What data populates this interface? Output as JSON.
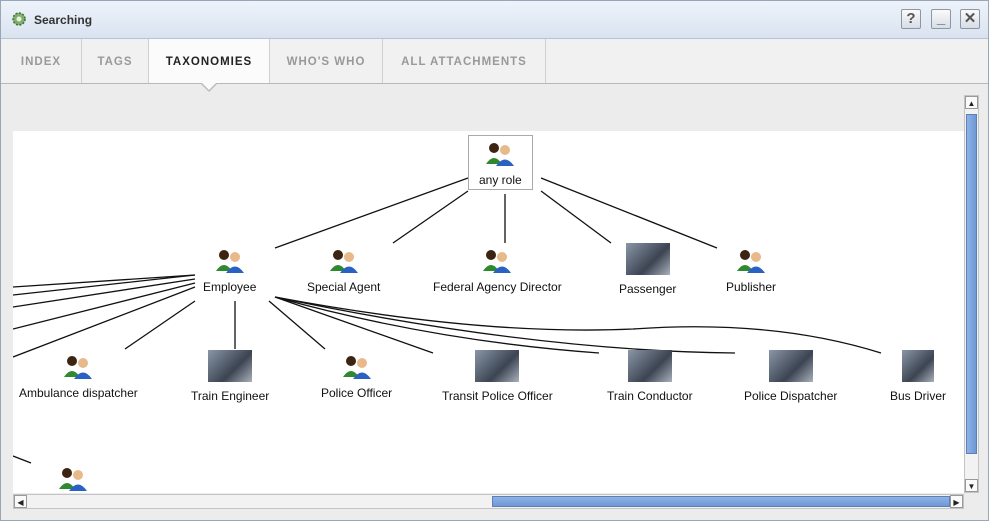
{
  "window": {
    "title": "Searching"
  },
  "controls": {
    "help": "?",
    "minimize": "_",
    "close": "✕"
  },
  "tabs": [
    {
      "label": "INDEX"
    },
    {
      "label": "TAGS"
    },
    {
      "label": "TAXONOMIES"
    },
    {
      "label": "WHO'S WHO"
    },
    {
      "label": "ALL ATTACHMENTS"
    }
  ],
  "active_tab": "TAXONOMIES",
  "taxonomy": {
    "root": {
      "label": "any role",
      "icon": "people-icon"
    },
    "level1": [
      {
        "label": "Employee",
        "icon": "people-icon"
      },
      {
        "label": "Special Agent",
        "icon": "people-icon"
      },
      {
        "label": "Federal Agency Director",
        "icon": "people-icon"
      },
      {
        "label": "Passenger",
        "icon": "photo-thumbnail"
      },
      {
        "label": "Publisher",
        "icon": "people-icon"
      }
    ],
    "level2": [
      {
        "label": "Ambulance dispatcher",
        "icon": "people-icon"
      },
      {
        "label": "Train Engineer",
        "icon": "photo-thumbnail"
      },
      {
        "label": "Police Officer",
        "icon": "people-icon"
      },
      {
        "label": "Transit Police Officer",
        "icon": "photo-thumbnail"
      },
      {
        "label": "Train Conductor",
        "icon": "photo-thumbnail"
      },
      {
        "label": "Police Dispatcher",
        "icon": "photo-thumbnail"
      },
      {
        "label": "Bus Driver",
        "icon": "photo-thumbnail"
      }
    ]
  }
}
